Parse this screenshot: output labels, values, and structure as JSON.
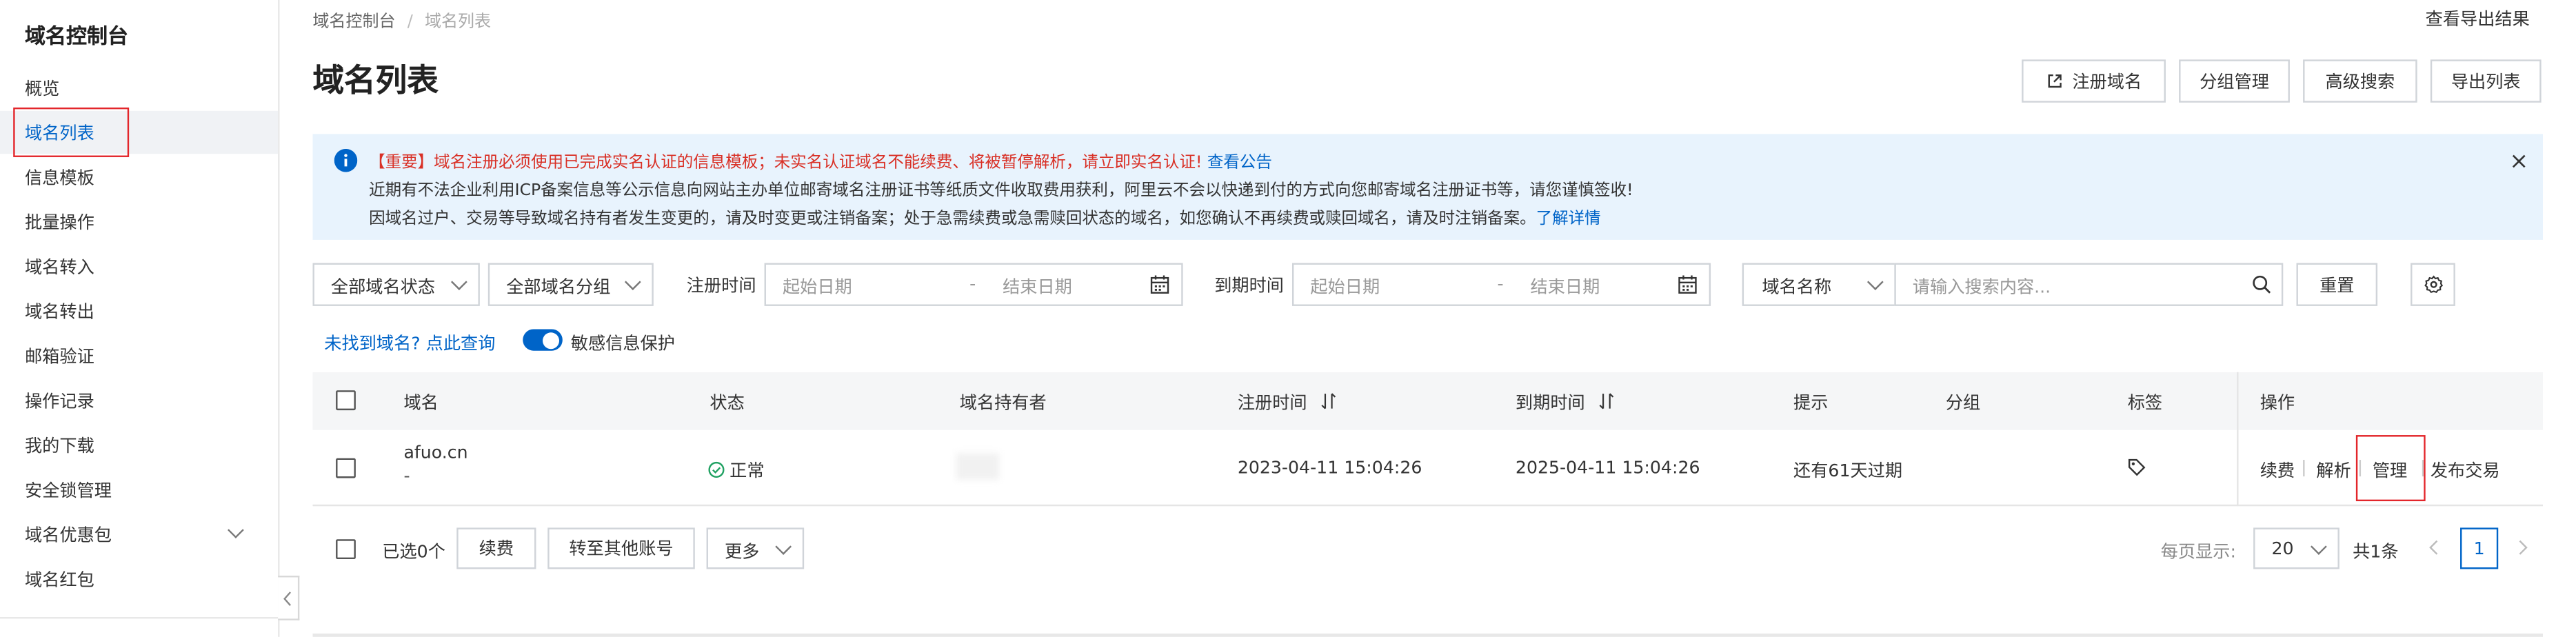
{
  "sidebar": {
    "title": "域名控制台",
    "items": [
      {
        "label": "概览"
      },
      {
        "label": "域名列表"
      },
      {
        "label": "信息模板"
      },
      {
        "label": "批量操作"
      },
      {
        "label": "域名转入"
      },
      {
        "label": "域名转出"
      },
      {
        "label": "邮箱验证"
      },
      {
        "label": "操作记录"
      },
      {
        "label": "我的下载"
      },
      {
        "label": "安全锁管理"
      },
      {
        "label": "域名优惠包"
      },
      {
        "label": "域名红包"
      }
    ]
  },
  "breadcrumb": {
    "root": "域名控制台",
    "sep": "/",
    "current": "域名列表"
  },
  "header": {
    "title": "域名列表",
    "export_results_link": "查看导出结果",
    "buttons": {
      "register": "注册域名",
      "group": "分组管理",
      "advanced": "高级搜索",
      "export": "导出列表"
    }
  },
  "notice": {
    "line1_important": "【重要】域名注册必须使用已完成实名认证的信息模板；未实名认证域名不能续费、将被暂停解析，请立即实名认证!",
    "line1_link": "查看公告",
    "line2": "近期有不法企业利用ICP备案信息等公示信息向网站主办单位邮寄域名注册证书等纸质文件收取费用获利，阿里云不会以快递到付的方式向您邮寄域名注册证书等，请您谨慎签收!",
    "line3": "因域名过户、交易等导致域名持有者发生变更的，请及时变更或注销备案；处于急需续费或急需赎回状态的域名，如您确认不再续费或赎回域名，请及时注销备案。",
    "line3_link": "了解详情"
  },
  "filters": {
    "status_select": "全部域名状态",
    "group_select": "全部域名分组",
    "reg_time_label": "注册时间",
    "reg_start_placeholder": "起始日期",
    "reg_end_placeholder": "结束日期",
    "exp_time_label": "到期时间",
    "exp_start_placeholder": "起始日期",
    "exp_end_placeholder": "结束日期",
    "search_field_select": "域名名称",
    "search_placeholder": "请输入搜索内容...",
    "reset": "重置",
    "date_sep": "-"
  },
  "helper": {
    "not_found_link": "未找到域名? 点此查询",
    "privacy_toggle_label": "敏感信息保护",
    "privacy_on": true
  },
  "table": {
    "headers": {
      "domain": "域名",
      "status": "状态",
      "holder": "域名持有者",
      "reg_time": "注册时间",
      "exp_time": "到期时间",
      "hint": "提示",
      "group": "分组",
      "tag": "标签",
      "ops": "操作"
    },
    "rows": [
      {
        "domain": "afuo.cn",
        "domain_sub": "-",
        "status": "正常",
        "reg_time": "2023-04-11 15:04:26",
        "exp_time": "2025-04-11 15:04:26",
        "hint": "还有61天过期",
        "ops": [
          "续费",
          "解析",
          "管理",
          "发布交易"
        ]
      }
    ]
  },
  "footer": {
    "selected": "已选0个",
    "renew": "续费",
    "transfer": "转至其他账号",
    "more": "更多",
    "per_page_label": "每页显示:",
    "per_page_value": "20",
    "total": "共1条",
    "page": "1"
  },
  "colors": {
    "accent": "#0064c8",
    "notice_bg": "#e8f3fd",
    "important_text": "#d93026",
    "highlight_box": "#e3262b",
    "success": "#20a162"
  }
}
